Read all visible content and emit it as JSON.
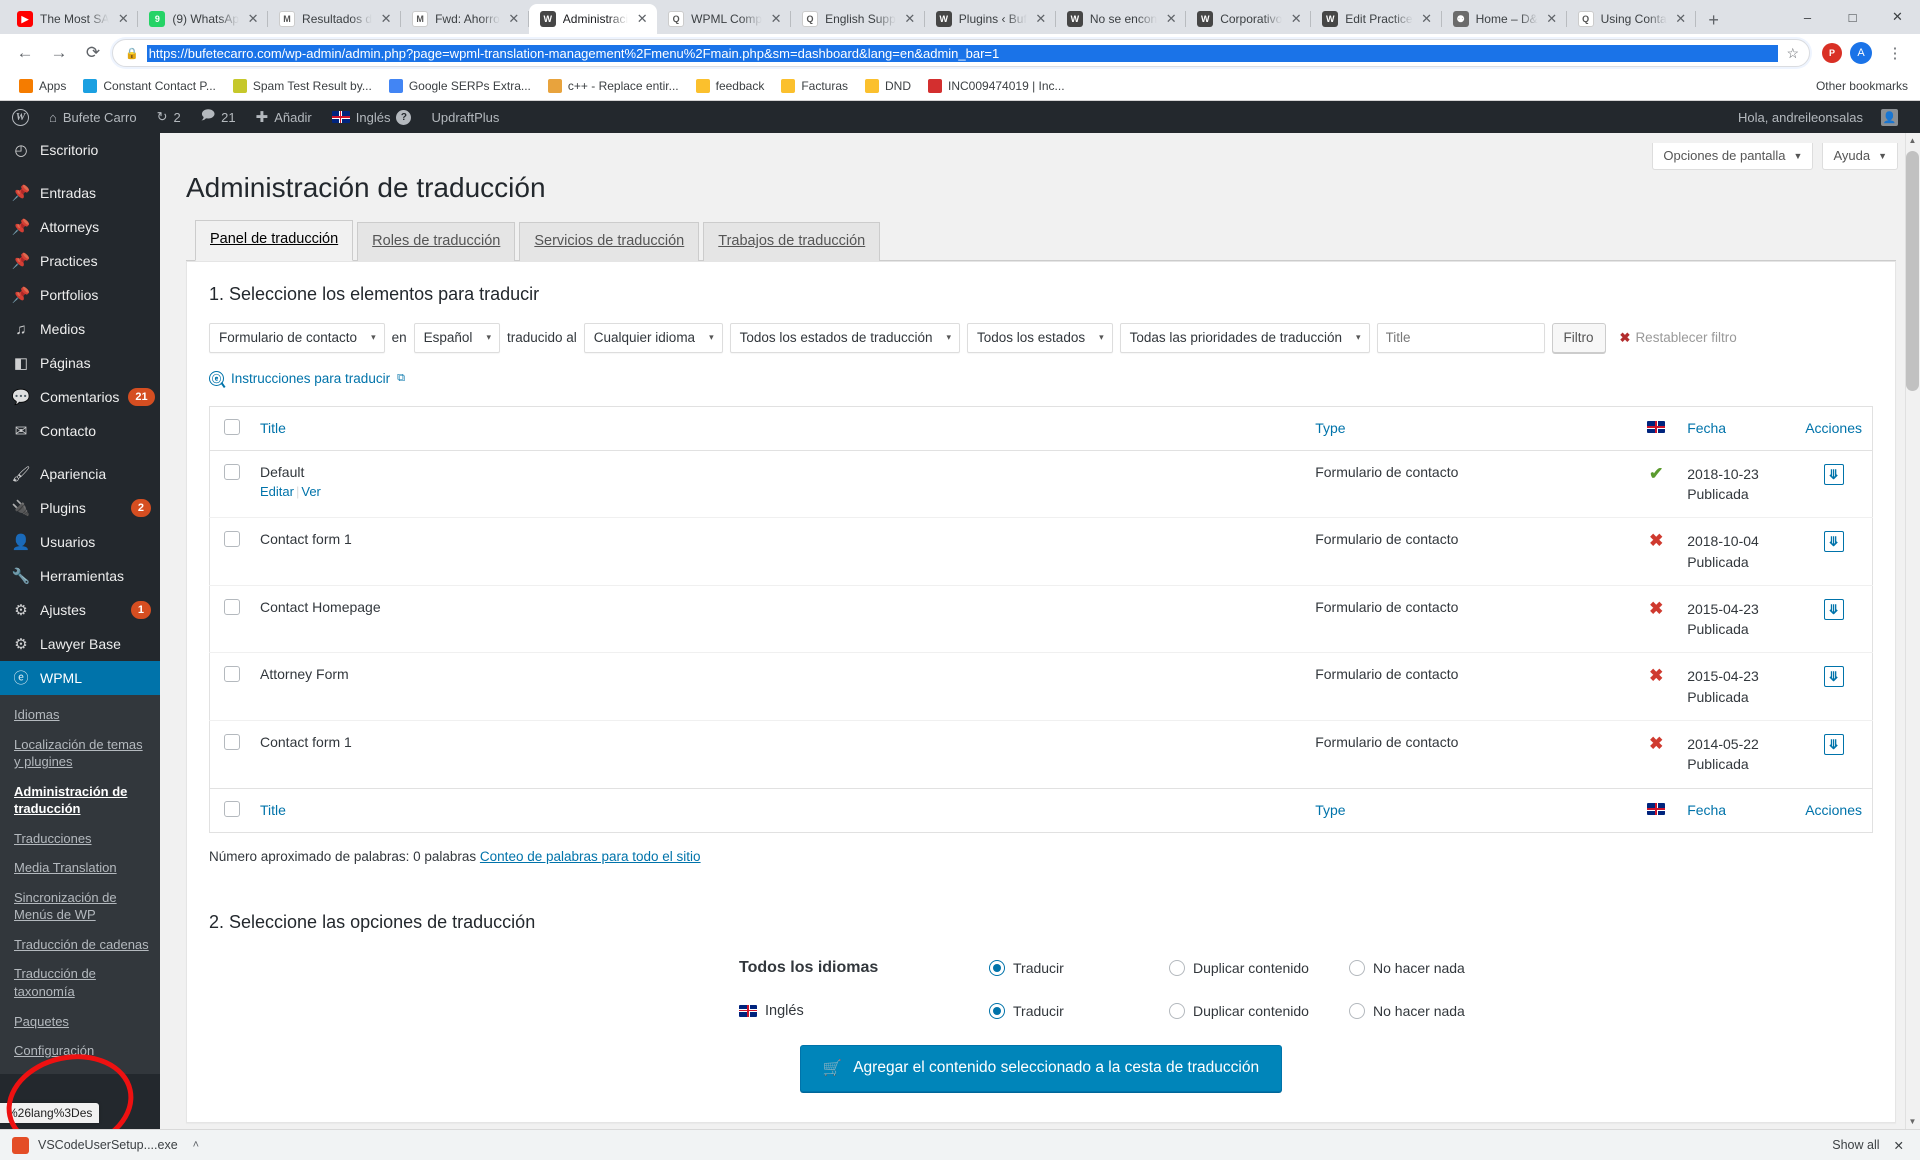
{
  "browser": {
    "tabs": [
      {
        "title": "The Most SA",
        "favicon": "youtube-icon",
        "color": "#ff0000",
        "glyph": "▶",
        "active": false
      },
      {
        "title": "(9) WhatsAp",
        "favicon": "whatsapp-icon",
        "color": "#25d366",
        "glyph": "9",
        "active": false
      },
      {
        "title": "Resultados d",
        "favicon": "gmail-icon",
        "color": "#ffffff",
        "glyph": "M",
        "active": false
      },
      {
        "title": "Fwd: Ahorro",
        "favicon": "gmail-icon",
        "color": "#ffffff",
        "glyph": "M",
        "active": false
      },
      {
        "title": "Administraci",
        "favicon": "wordpress-icon",
        "color": "#464646",
        "glyph": "W",
        "active": true
      },
      {
        "title": "WPML Comp",
        "favicon": "wpml-icon",
        "color": "#ffffff",
        "glyph": "Q",
        "active": false
      },
      {
        "title": "English Supp",
        "favicon": "wpml-icon",
        "color": "#ffffff",
        "glyph": "Q",
        "active": false
      },
      {
        "title": "Plugins ‹ Buf",
        "favicon": "wordpress-icon",
        "color": "#464646",
        "glyph": "W",
        "active": false
      },
      {
        "title": "No se encon",
        "favicon": "wordpress-icon",
        "color": "#464646",
        "glyph": "W",
        "active": false
      },
      {
        "title": "Corporativo",
        "favicon": "wordpress-icon",
        "color": "#464646",
        "glyph": "W",
        "active": false
      },
      {
        "title": "Edit Practice",
        "favicon": "wordpress-icon",
        "color": "#464646",
        "glyph": "W",
        "active": false
      },
      {
        "title": "Home – D&",
        "favicon": "site-icon",
        "color": "#6b6b6b",
        "glyph": "⚉",
        "active": false
      },
      {
        "title": "Using Conta",
        "favicon": "wpml-icon",
        "color": "#ffffff",
        "glyph": "Q",
        "active": false
      }
    ],
    "newtab_label": "+",
    "window_controls": {
      "minimize": "–",
      "maximize": "□",
      "close": "✕"
    },
    "nav": {
      "back": "←",
      "forward": "→",
      "reload": "⟳"
    },
    "url": "https://bufetecarro.com/wp-admin/admin.php?page=wpml-translation-management%2Fmenu%2Fmain.php&sm=dashboard&lang=en&admin_bar=1",
    "lock_icon": "lock-icon",
    "star_icon": "☆",
    "profile_initial": "A",
    "bookmarks": [
      {
        "label": "Apps",
        "icon": "apps-grid-icon",
        "color": "#f57c00"
      },
      {
        "label": "Constant Contact P...",
        "icon": "folder-icon",
        "color": "#1ba0e1"
      },
      {
        "label": "Spam Test Result by...",
        "icon": "leaf-icon",
        "color": "#c6c82b"
      },
      {
        "label": "Google SERPs Extra...",
        "icon": "chrome-icon",
        "color": "#4285f4"
      },
      {
        "label": "c++ - Replace entir...",
        "icon": "script-icon",
        "color": "#e8a33d"
      },
      {
        "label": "feedback",
        "icon": "folder-icon",
        "color": "#fbc02d"
      },
      {
        "label": "Facturas",
        "icon": "folder-icon",
        "color": "#fbc02d"
      },
      {
        "label": "DND",
        "icon": "folder-icon",
        "color": "#fbc02d"
      },
      {
        "label": "INC009474019 | Inc...",
        "icon": "pdf-icon",
        "color": "#d32f2f"
      }
    ],
    "other_bookmarks": {
      "label": "Other bookmarks",
      "icon": "folder-icon"
    }
  },
  "adminbar": {
    "logo": "wordpress-logo-icon",
    "site_name": "Bufete Carro",
    "updates_count": "2",
    "comments_count": "21",
    "new_label": "Añadir",
    "language_label": "Inglés",
    "help_icon": "question-icon",
    "plugin_label": "UpdraftPlus",
    "greeting": "Hola, andreileonsalas"
  },
  "sidebar": {
    "items": [
      {
        "label": "Escritorio",
        "icon": "dashboard-icon",
        "glyph": "◴",
        "badge": null,
        "gap": false
      },
      {
        "label": "Entradas",
        "icon": "pin-icon",
        "glyph": "📌",
        "badge": null,
        "gap": true
      },
      {
        "label": "Attorneys",
        "icon": "pin-icon",
        "glyph": "📌",
        "badge": null,
        "gap": false
      },
      {
        "label": "Practices",
        "icon": "pin-icon",
        "glyph": "📌",
        "badge": null,
        "gap": false
      },
      {
        "label": "Portfolios",
        "icon": "pin-icon",
        "glyph": "📌",
        "badge": null,
        "gap": false
      },
      {
        "label": "Medios",
        "icon": "media-icon",
        "glyph": "♫",
        "badge": null,
        "gap": false
      },
      {
        "label": "Páginas",
        "icon": "pages-icon",
        "glyph": "◧",
        "badge": null,
        "gap": false
      },
      {
        "label": "Comentarios",
        "icon": "comment-icon",
        "glyph": "💬",
        "badge": "21",
        "gap": false
      },
      {
        "label": "Contacto",
        "icon": "mail-icon",
        "glyph": "✉",
        "badge": null,
        "gap": false
      },
      {
        "label": "Apariencia",
        "icon": "brush-icon",
        "glyph": "🖌",
        "badge": null,
        "gap": true
      },
      {
        "label": "Plugins",
        "icon": "plug-icon",
        "glyph": "🔌",
        "badge": "2",
        "gap": false
      },
      {
        "label": "Usuarios",
        "icon": "users-icon",
        "glyph": "👤",
        "badge": null,
        "gap": false
      },
      {
        "label": "Herramientas",
        "icon": "wrench-icon",
        "glyph": "🔧",
        "badge": null,
        "gap": false
      },
      {
        "label": "Ajustes",
        "icon": "settings-icon",
        "glyph": "⚙",
        "badge": "1",
        "gap": false
      },
      {
        "label": "Lawyer Base",
        "icon": "gear-icon",
        "glyph": "⚙",
        "badge": null,
        "gap": false
      }
    ],
    "wpml": {
      "label": "WPML",
      "icon": "wpml-icon"
    },
    "submenu": [
      {
        "label": "Idiomas",
        "current": false
      },
      {
        "label": "Localización de temas y plugines",
        "current": false
      },
      {
        "label": "Administración de traducción",
        "current": true
      },
      {
        "label": "Traducciones",
        "current": false
      },
      {
        "label": "Media Translation",
        "current": false
      },
      {
        "label": "Sincronización de Menús de WP",
        "current": false
      },
      {
        "label": "Traducción de cadenas",
        "current": false
      },
      {
        "label": "Traducción de taxonomía",
        "current": false
      },
      {
        "label": "Paquetes",
        "current": false
      },
      {
        "label": "Configuración",
        "current": false
      }
    ],
    "status_tooltip": "%26lang%3Des"
  },
  "screen_meta": {
    "options_label": "Opciones de pantalla",
    "help_label": "Ayuda",
    "caret": "▼"
  },
  "page": {
    "title": "Administración de traducción",
    "tabs": [
      {
        "label": "Panel de traducción",
        "active": true
      },
      {
        "label": "Roles de traducción",
        "active": false
      },
      {
        "label": "Servicios de traducción",
        "active": false
      },
      {
        "label": "Trabajos de traducción",
        "active": false
      }
    ]
  },
  "step1": {
    "heading": "1. Seleccione los elementos para traducir",
    "filters": {
      "post_type": "Formulario de contacto",
      "word_en": "en",
      "language": "Español",
      "word_translated": "traducido al",
      "target_language": "Cualquier idioma",
      "translation_status": "Todos los estados de traducción",
      "status": "Todos los estados",
      "priority": "Todas las prioridades de traducción",
      "title_placeholder": "Title",
      "title_value": "",
      "filter_button": "Filtro",
      "reset_label": "Restablecer filtro",
      "reset_icon": "x-mark-icon",
      "caret": "▾"
    },
    "instructions_link": "Instrucciones para traducir",
    "instructions_icon": "external-link-icon"
  },
  "table": {
    "headers": {
      "title": "Title",
      "type": "Type",
      "flag": "english-flag-icon",
      "date": "Fecha",
      "actions": "Acciones"
    },
    "rows": [
      {
        "title": "Default",
        "actions": [
          "Editar",
          "Ver"
        ],
        "type": "Formulario de contacto",
        "translated": true,
        "date": "2018-10-23",
        "status": "Publicada",
        "action_icon": "add-to-basket-icon"
      },
      {
        "title": "Contact form 1",
        "actions": [],
        "type": "Formulario de contacto",
        "translated": false,
        "date": "2018-10-04",
        "status": "Publicada",
        "action_icon": "add-to-basket-icon"
      },
      {
        "title": "Contact Homepage",
        "actions": [],
        "type": "Formulario de contacto",
        "translated": false,
        "date": "2015-04-23",
        "status": "Publicada",
        "action_icon": "add-to-basket-icon"
      },
      {
        "title": "Attorney Form",
        "actions": [],
        "type": "Formulario de contacto",
        "translated": false,
        "date": "2015-04-23",
        "status": "Publicada",
        "action_icon": "add-to-basket-icon"
      },
      {
        "title": "Contact form 1",
        "actions": [],
        "type": "Formulario de contacto",
        "translated": false,
        "date": "2014-05-22",
        "status": "Publicada",
        "action_icon": "add-to-basket-icon"
      }
    ],
    "tick_glyph": "✔",
    "cross_glyph": "✖"
  },
  "wordcount": {
    "text": "Número aproximado de palabras: 0 palabras",
    "link": "Conteo de palabras para todo el sitio"
  },
  "step2": {
    "heading": "2. Seleccione las opciones de traducción",
    "rows": [
      {
        "label": "Todos los idiomas",
        "bold": true,
        "flag": null,
        "options": [
          {
            "label": "Traducir",
            "checked": true
          },
          {
            "label": "Duplicar contenido",
            "checked": false
          },
          {
            "label": "No hacer nada",
            "checked": false
          }
        ]
      },
      {
        "label": "Inglés",
        "bold": false,
        "flag": "english-flag-icon",
        "options": [
          {
            "label": "Traducir",
            "checked": true
          },
          {
            "label": "Duplicar contenido",
            "checked": false
          },
          {
            "label": "No hacer nada",
            "checked": false
          }
        ]
      }
    ],
    "cta_label": "Agregar el contenido seleccionado a la cesta de traducción",
    "cta_icon": "basket-icon"
  },
  "taskbar": {
    "download_name": "VSCodeUserSetup....exe",
    "download_icon": "exe-file-icon",
    "caret": "˄",
    "show_all": "Show all",
    "close_icon": "✕"
  },
  "colors": {
    "accent": "#0073aa",
    "cta": "#0085ba",
    "badge": "#d54e21",
    "tick": "#5b9b2e",
    "cross": "#cf3a2f",
    "url_highlight": "#1a73e8",
    "annotation": "#ee1111"
  }
}
